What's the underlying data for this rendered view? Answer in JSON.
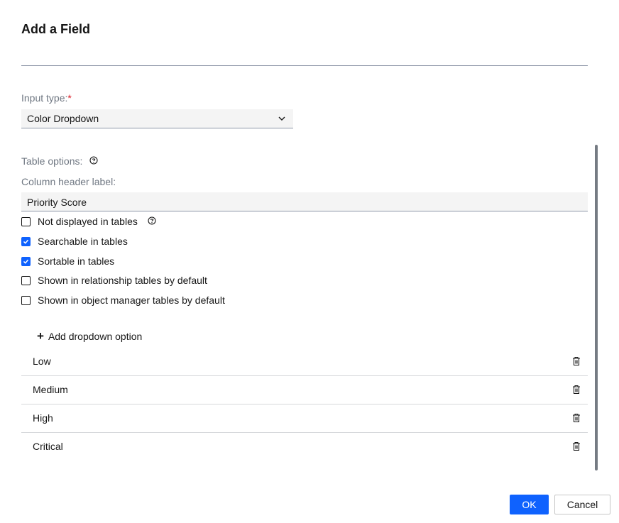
{
  "dialog": {
    "title": "Add a Field",
    "name_value": ""
  },
  "input_type": {
    "label": "Input type:",
    "required_mark": "*",
    "selected": "Color Dropdown"
  },
  "table_options": {
    "label": "Table options:",
    "column_header_label": "Column header label:",
    "column_header_value": "Priority Score",
    "checkboxes": [
      {
        "label": "Not displayed in tables",
        "checked": false,
        "has_help": true
      },
      {
        "label": "Searchable in tables",
        "checked": true
      },
      {
        "label": "Sortable in tables",
        "checked": true
      },
      {
        "label": "Shown in relationship tables by default",
        "checked": false
      },
      {
        "label": "Shown in object manager tables by default",
        "checked": false
      }
    ]
  },
  "dropdown_options": {
    "add_label": "Add dropdown option",
    "items": [
      "Low",
      "Medium",
      "High",
      "Critical"
    ]
  },
  "footer": {
    "ok_label": "OK",
    "cancel_label": "Cancel"
  },
  "colors": {
    "primary": "#0f62fe",
    "required": "#da1e28"
  }
}
